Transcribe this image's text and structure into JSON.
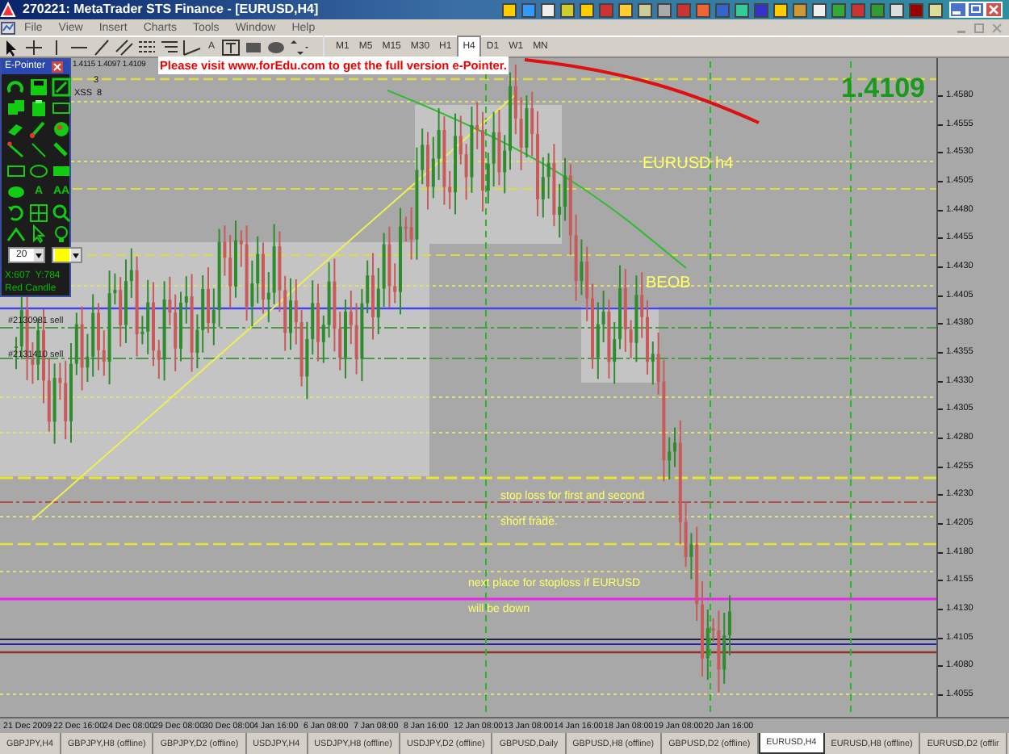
{
  "window": {
    "title": "270221: MetaTrader STS Finance - [EURUSD,H4]"
  },
  "menu": [
    "File",
    "View",
    "Insert",
    "Charts",
    "Tools",
    "Window",
    "Help"
  ],
  "toolbar": {
    "text_tool": "A"
  },
  "timeframes": [
    {
      "label": "M1",
      "selected": false
    },
    {
      "label": "M5",
      "selected": false
    },
    {
      "label": "M15",
      "selected": false
    },
    {
      "label": "M30",
      "selected": false
    },
    {
      "label": "H1",
      "selected": false
    },
    {
      "label": "H4",
      "selected": true
    },
    {
      "label": "D1",
      "selected": false
    },
    {
      "label": "W1",
      "selected": false
    },
    {
      "label": "MN",
      "selected": false
    }
  ],
  "chart": {
    "ohlc": "1.4115 1.4097 1.4109",
    "indicator_value": "3",
    "indicator_label": "XSS  8",
    "notice": "Please visit www.forEdu.com to get the full version e-Pointer.",
    "last_price": "1.4109",
    "annotations": [
      {
        "kind": "title",
        "text": "EURUSD h4"
      },
      {
        "kind": "title",
        "text": "BEOB"
      },
      {
        "kind": "note",
        "text": "stop loss for first and second short trade."
      },
      {
        "kind": "note",
        "text": "next place for stoploss if EURUSD will be down"
      },
      {
        "kind": "order",
        "text": "#2130981 sell"
      },
      {
        "kind": "order",
        "text": "#2131410 sell"
      }
    ],
    "price_axis": [
      "1.4580",
      "1.4555",
      "1.4530",
      "1.4505",
      "1.4480",
      "1.4455",
      "1.4430",
      "1.4405",
      "1.4380",
      "1.4355",
      "1.4330",
      "1.4305",
      "1.4280",
      "1.4255",
      "1.4230",
      "1.4205",
      "1.4180",
      "1.4155",
      "1.4130",
      "1.4105",
      "1.4080",
      "1.4055"
    ],
    "time_axis": [
      "21 Dec 2009",
      "22 Dec 16:00",
      "24 Dec 08:00",
      "29 Dec 08:00",
      "30 Dec 08:00",
      "4 Jan 16:00",
      "6 Jan 08:00",
      "7 Jan 08:00",
      "8 Jan 16:00",
      "12 Jan 08:00",
      "13 Jan 08:00",
      "14 Jan 16:00",
      "18 Jan 08:00",
      "19 Jan 08:00",
      "20 Jan 16:00"
    ]
  },
  "epointer": {
    "title": "E-Pointer",
    "text_tools": [
      "A",
      "AA"
    ],
    "size": "20",
    "color": "#ffff00",
    "coords": "X:607  Y:784",
    "status": "Red Candle"
  },
  "tabs": [
    {
      "label": "GBPJPY,H4",
      "selected": false
    },
    {
      "label": "GBPJPY,H8 (offline)",
      "selected": false
    },
    {
      "label": "GBPJPY,D2 (offline)",
      "selected": false
    },
    {
      "label": "USDJPY,H4",
      "selected": false
    },
    {
      "label": "USDJPY,H8 (offline)",
      "selected": false
    },
    {
      "label": "USDJPY,D2 (offline)",
      "selected": false
    },
    {
      "label": "GBPUSD,Daily",
      "selected": false
    },
    {
      "label": "GBPUSD,H8 (offline)",
      "selected": false
    },
    {
      "label": "GBPUSD,D2 (offline)",
      "selected": false
    },
    {
      "label": "EURUSD,H4",
      "selected": true
    },
    {
      "label": "EURUSD,H8 (offline)",
      "selected": false
    },
    {
      "label": "EURUSD,D2 (offlir",
      "selected": false
    }
  ]
}
